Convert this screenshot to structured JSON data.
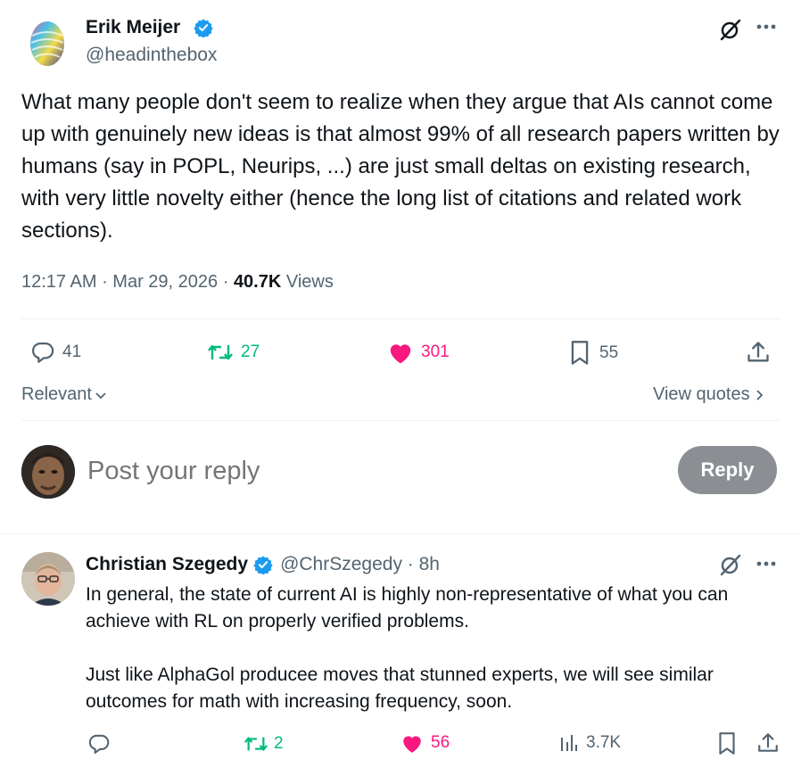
{
  "tweet": {
    "author_name": "Erik Meijer",
    "author_handle": "@headinthebox",
    "text": "What many people don't seem to realize when they argue that AIs cannot come up with genuinely new ideas is that almost 99% of all research papers written by humans (say in POPL, Neurips, ...) are just small deltas on existing research, with very little novelty either (hence the long list of citations and related work sections).",
    "time": "12:17 AM",
    "date": "Mar 29, 2026",
    "views_count": "40.7K",
    "views_label": "Views",
    "replies": "41",
    "reposts": "27",
    "likes": "301",
    "bookmarks": "55"
  },
  "sort": {
    "label": "Relevant",
    "view_quotes": "View quotes"
  },
  "composer": {
    "placeholder": "Post your reply",
    "reply_button": "Reply"
  },
  "reply": {
    "author_name": "Christian Szegedy",
    "author_handle": "@ChrSzegedy",
    "time_ago": "8h",
    "text": "In general, the state of current AI is highly non-representative of what you can achieve with RL on properly verified problems.\n\nJust like AlphaGol producee moves that stunned experts, we will see similar outcomes for math with increasing frequency, soon.",
    "reposts": "2",
    "likes": "56",
    "views": "3.7K"
  },
  "colors": {
    "verified": "#1d9bf0",
    "like": "#f91880",
    "repost": "#00ba7c",
    "muted": "#536471"
  }
}
